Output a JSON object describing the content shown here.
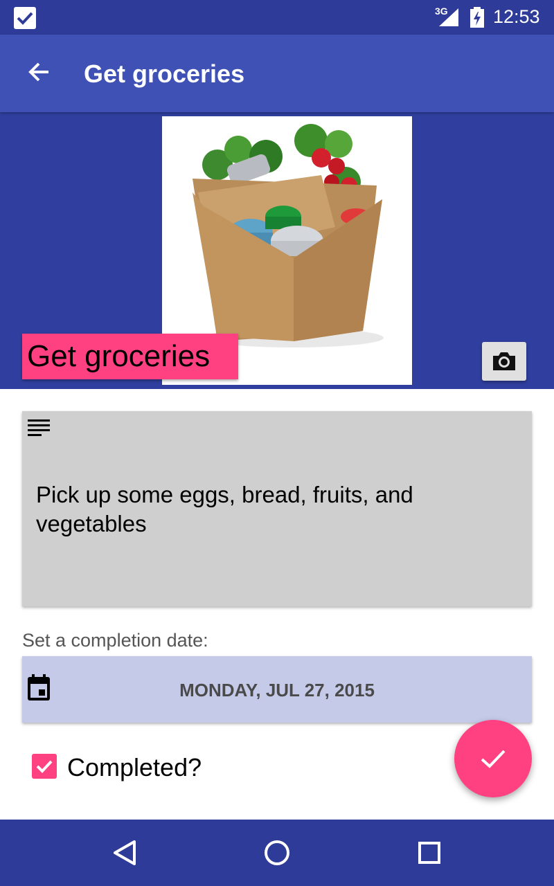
{
  "status_bar": {
    "time": "12:53",
    "network": "3G",
    "icons": [
      "app-check-icon",
      "signal-icon",
      "battery-charging-icon"
    ]
  },
  "app_bar": {
    "title": "Get groceries",
    "back_icon": "arrow-back-icon"
  },
  "hero": {
    "title_chip": "Get groceries",
    "photo_subject": "grocery-bag-photo",
    "camera_icon": "camera-icon"
  },
  "description": {
    "icon": "notes-icon",
    "text": "Pick up some eggs, bread, fruits, and vegetables"
  },
  "completion": {
    "label": "Set a completion date:",
    "date": "MONDAY, JUL 27, 2015",
    "date_icon": "calendar-icon"
  },
  "completed": {
    "label": "Completed?",
    "checked": true
  },
  "fab": {
    "icon": "check-icon"
  },
  "nav_bar": {
    "icons": [
      "back-triangle-icon",
      "home-circle-icon",
      "recents-square-icon"
    ]
  },
  "colors": {
    "primary": "#3f51b5",
    "primary_dark": "#303f9f",
    "accent": "#ff4081",
    "date_bg": "#c5cae9",
    "desc_bg": "#cfcfcf"
  }
}
